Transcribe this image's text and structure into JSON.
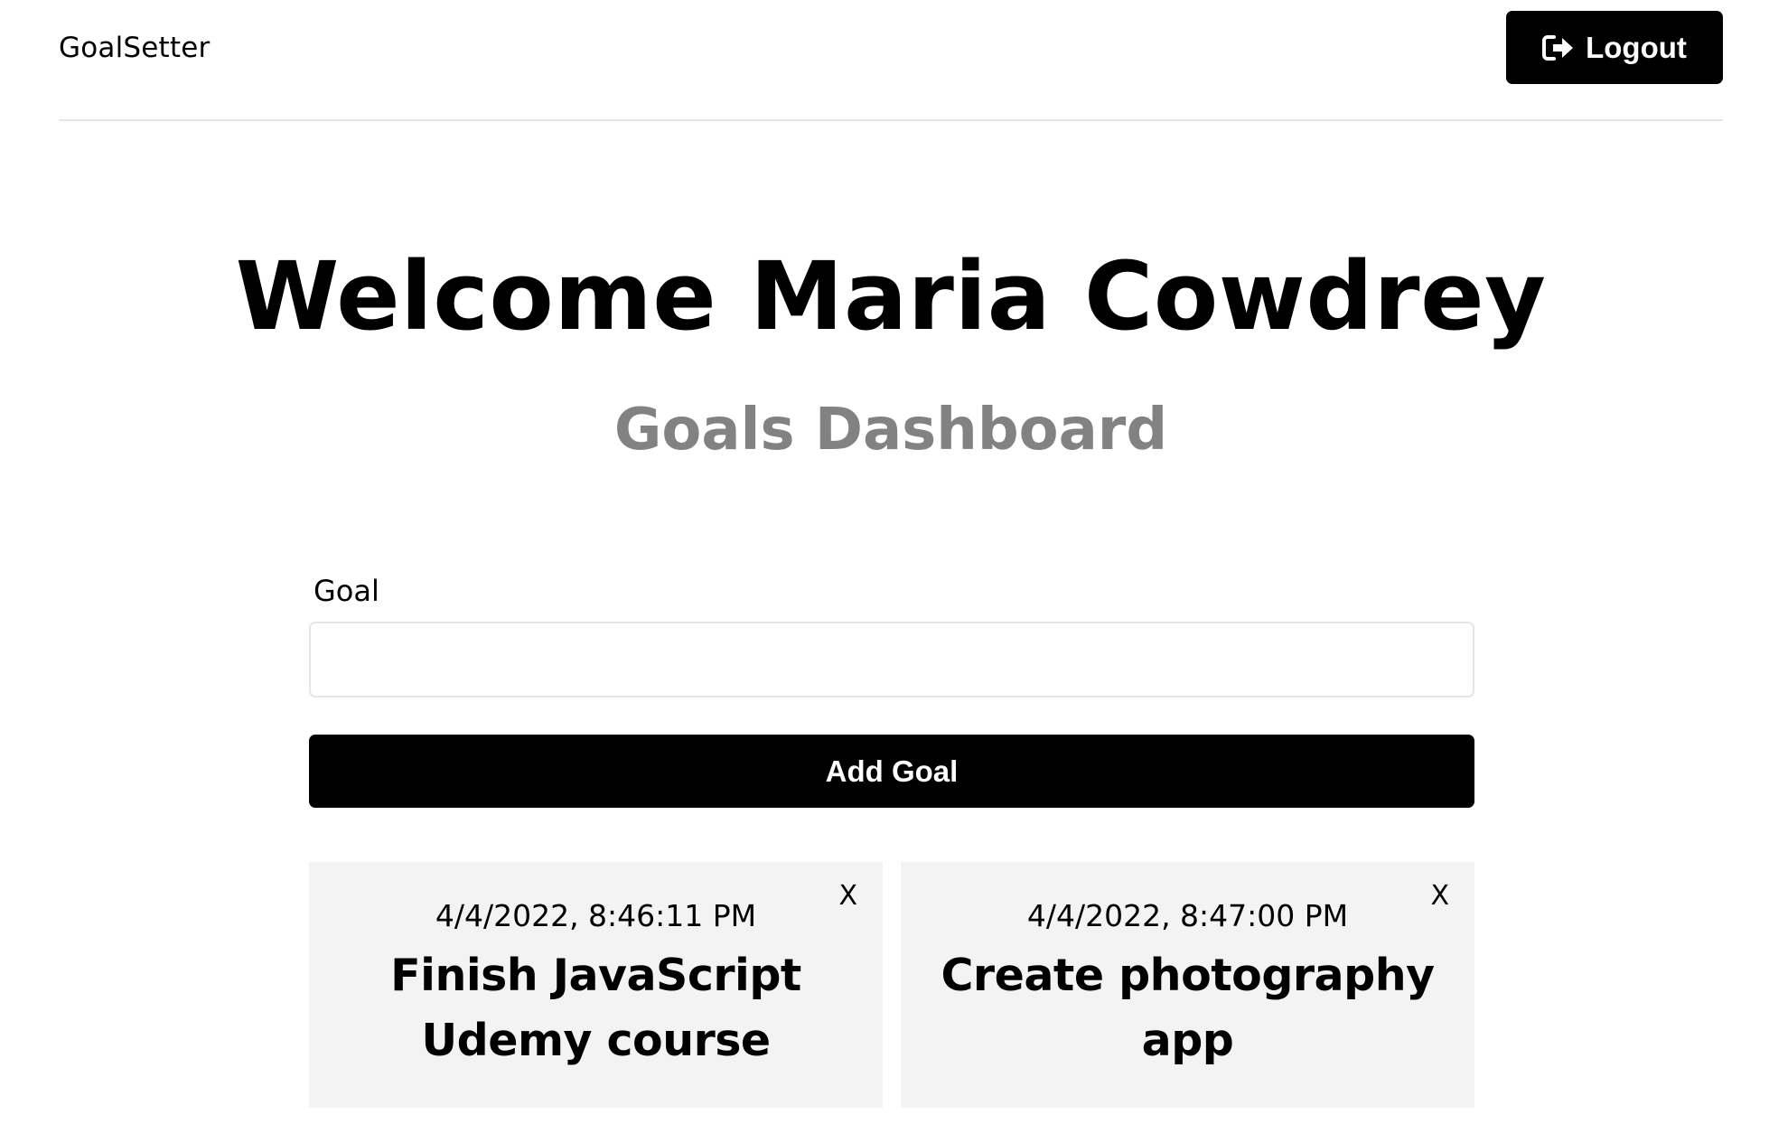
{
  "header": {
    "brand": "GoalSetter",
    "logout_label": "Logout",
    "logout_icon": "sign-out-icon"
  },
  "main": {
    "welcome": "Welcome Maria Cowdrey",
    "subtitle": "Goals Dashboard"
  },
  "form": {
    "label": "Goal",
    "value": "",
    "placeholder": "",
    "submit_label": "Add Goal"
  },
  "goals": [
    {
      "date": "4/4/2022, 8:46:11 PM",
      "text": "Finish JavaScript Udemy course",
      "delete_label": "X"
    },
    {
      "date": "4/4/2022, 8:47:00 PM",
      "text": "Create photography app",
      "delete_label": "X"
    }
  ],
  "colors": {
    "primary": "#000000",
    "subtitle": "#828282",
    "card_bg": "#f3f3f3",
    "border": "#e6e6e6"
  }
}
